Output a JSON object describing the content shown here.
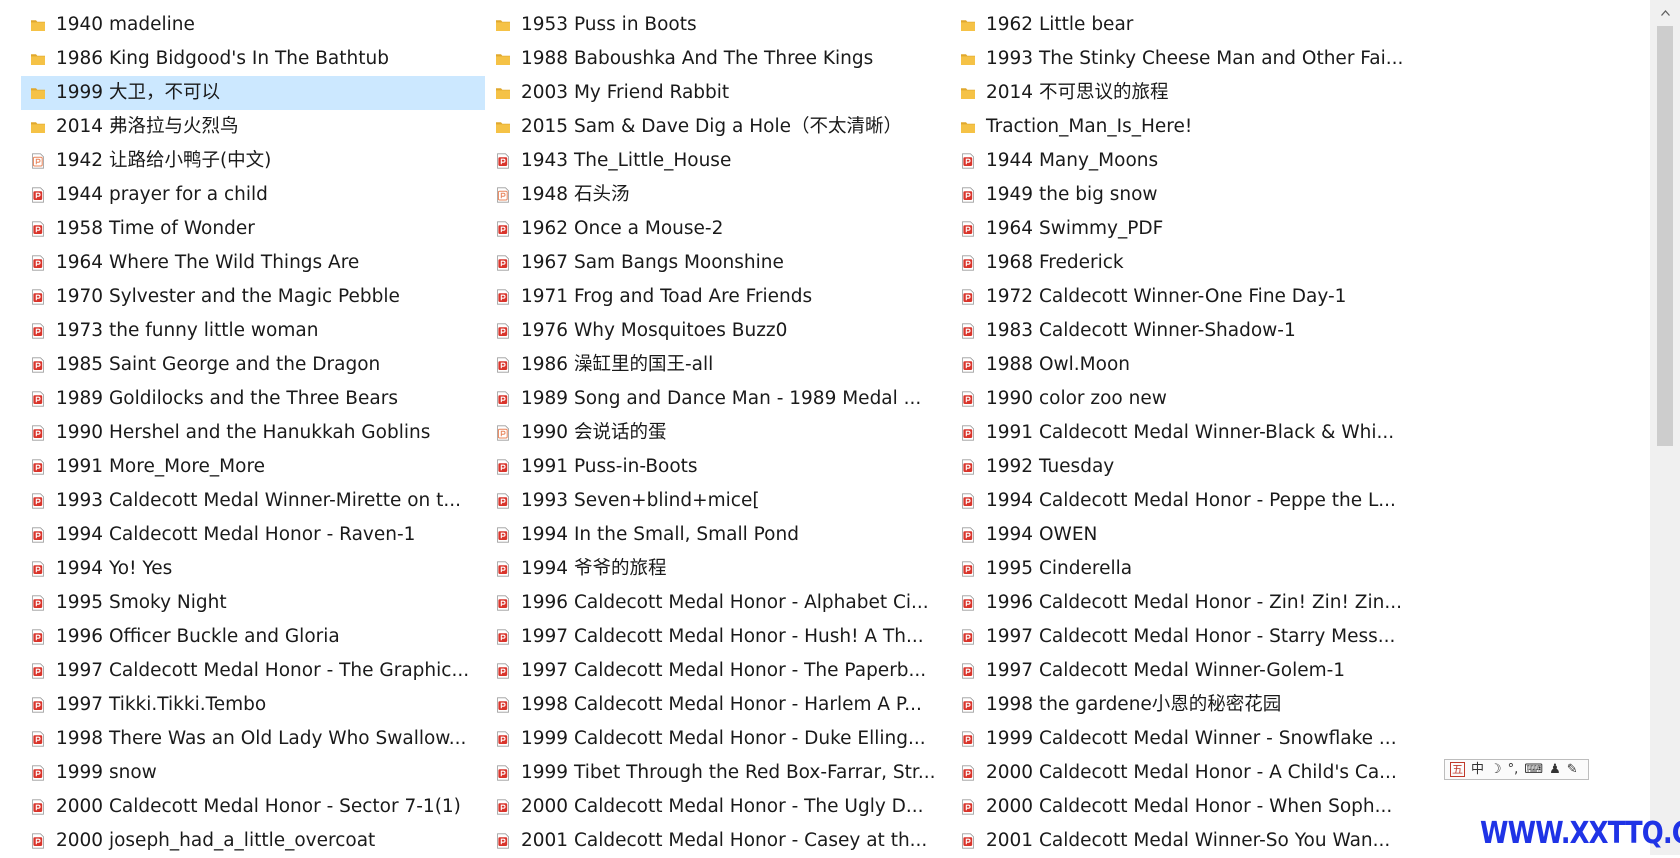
{
  "columns": [
    [
      {
        "type": "folder",
        "name": "1940 madeline"
      },
      {
        "type": "folder",
        "name": "1986 King Bidgood's In The Bathtub"
      },
      {
        "type": "folder",
        "name": "1999 大卫，不可以",
        "selected": true
      },
      {
        "type": "folder",
        "name": "2014 弗洛拉与火烈鸟"
      },
      {
        "type": "pdf-light",
        "name": "1942 让路给小鸭子(中文)"
      },
      {
        "type": "pdf",
        "name": "1944 prayer for a child"
      },
      {
        "type": "pdf",
        "name": "1958 Time of Wonder"
      },
      {
        "type": "pdf",
        "name": "1964 Where The Wild Things Are"
      },
      {
        "type": "pdf",
        "name": "1970 Sylvester and the Magic Pebble"
      },
      {
        "type": "pdf",
        "name": "1973 the funny little woman"
      },
      {
        "type": "pdf",
        "name": "1985 Saint George and the Dragon"
      },
      {
        "type": "pdf",
        "name": "1989 Goldilocks and the Three Bears"
      },
      {
        "type": "pdf",
        "name": "1990 Hershel and the Hanukkah Goblins"
      },
      {
        "type": "pdf",
        "name": "1991 More_More_More"
      },
      {
        "type": "pdf",
        "name": "1993 Caldecott Medal Winner-Mirette on t..."
      },
      {
        "type": "pdf",
        "name": "1994 Caldecott Medal Honor - Raven-1"
      },
      {
        "type": "pdf",
        "name": "1994 Yo! Yes"
      },
      {
        "type": "pdf",
        "name": "1995 Smoky Night"
      },
      {
        "type": "pdf",
        "name": "1996 Officer Buckle and Gloria"
      },
      {
        "type": "pdf",
        "name": "1997 Caldecott Medal Honor - The Graphic..."
      },
      {
        "type": "pdf",
        "name": "1997 Tikki.Tikki.Tembo"
      },
      {
        "type": "pdf",
        "name": "1998 There Was an Old Lady Who Swallow..."
      },
      {
        "type": "pdf",
        "name": "1999 snow"
      },
      {
        "type": "pdf",
        "name": "2000 Caldecott Medal Honor - Sector 7-1(1)"
      },
      {
        "type": "pdf",
        "name": "2000 joseph_had_a_little_overcoat"
      }
    ],
    [
      {
        "type": "folder",
        "name": "1953 Puss in Boots"
      },
      {
        "type": "folder",
        "name": "1988 Baboushka And The Three Kings"
      },
      {
        "type": "folder",
        "name": "2003 My Friend Rabbit"
      },
      {
        "type": "folder",
        "name": "2015 Sam & Dave Dig a Hole（不太清晰）"
      },
      {
        "type": "pdf",
        "name": "1943 The_Little_House"
      },
      {
        "type": "pdf-light",
        "name": "1948 石头汤"
      },
      {
        "type": "pdf",
        "name": "1962 Once a Mouse-2"
      },
      {
        "type": "pdf",
        "name": "1967 Sam Bangs Moonshine"
      },
      {
        "type": "pdf",
        "name": "1971 Frog and Toad Are Friends"
      },
      {
        "type": "pdf",
        "name": "1976 Why Mosquitoes Buzz0"
      },
      {
        "type": "pdf",
        "name": "1986 澡缸里的国王-all"
      },
      {
        "type": "pdf",
        "name": "1989 Song and Dance Man - 1989 Medal ..."
      },
      {
        "type": "pdf-light",
        "name": "1990 会说话的蛋"
      },
      {
        "type": "pdf",
        "name": "1991 Puss-in-Boots"
      },
      {
        "type": "pdf",
        "name": "1993 Seven+blind+mice["
      },
      {
        "type": "pdf",
        "name": "1994 In the Small, Small Pond"
      },
      {
        "type": "pdf",
        "name": "1994 爷爷的旅程"
      },
      {
        "type": "pdf",
        "name": "1996 Caldecott Medal Honor - Alphabet Ci..."
      },
      {
        "type": "pdf",
        "name": "1997 Caldecott Medal Honor - Hush! A Th..."
      },
      {
        "type": "pdf",
        "name": "1997 Caldecott Medal Honor - The Paperb..."
      },
      {
        "type": "pdf",
        "name": "1998 Caldecott Medal Honor - Harlem A P..."
      },
      {
        "type": "pdf",
        "name": "1999 Caldecott Medal Honor - Duke Elling..."
      },
      {
        "type": "pdf",
        "name": "1999 Tibet Through the Red Box-Farrar, Str..."
      },
      {
        "type": "pdf",
        "name": "2000 Caldecott Medal Honor - The Ugly D..."
      },
      {
        "type": "pdf",
        "name": "2001 Caldecott Medal Honor - Casey at th..."
      }
    ],
    [
      {
        "type": "folder",
        "name": "1962 Little bear"
      },
      {
        "type": "folder",
        "name": "1993 The Stinky Cheese Man and Other Fai..."
      },
      {
        "type": "folder",
        "name": "2014 不可思议的旅程"
      },
      {
        "type": "folder",
        "name": "Traction_Man_Is_Here!"
      },
      {
        "type": "pdf",
        "name": "1944 Many_Moons"
      },
      {
        "type": "pdf",
        "name": "1949 the big snow"
      },
      {
        "type": "pdf",
        "name": "1964 Swimmy_PDF"
      },
      {
        "type": "pdf",
        "name": "1968 Frederick"
      },
      {
        "type": "pdf",
        "name": "1972 Caldecott Winner-One Fine Day-1"
      },
      {
        "type": "pdf",
        "name": "1983 Caldecott Winner-Shadow-1"
      },
      {
        "type": "pdf",
        "name": "1988 Owl.Moon"
      },
      {
        "type": "pdf",
        "name": "1990 color zoo new"
      },
      {
        "type": "pdf",
        "name": "1991 Caldecott Medal Winner-Black & Whi..."
      },
      {
        "type": "pdf",
        "name": "1992 Tuesday"
      },
      {
        "type": "pdf",
        "name": "1994 Caldecott Medal Honor - Peppe the L..."
      },
      {
        "type": "pdf",
        "name": "1994 OWEN"
      },
      {
        "type": "pdf",
        "name": "1995 Cinderella"
      },
      {
        "type": "pdf",
        "name": "1996 Caldecott Medal Honor - Zin! Zin! Zin..."
      },
      {
        "type": "pdf",
        "name": "1997 Caldecott Medal Honor - Starry Mess..."
      },
      {
        "type": "pdf",
        "name": "1997 Caldecott Medal Winner-Golem-1"
      },
      {
        "type": "pdf",
        "name": "1998 the gardene小恩的秘密花园"
      },
      {
        "type": "pdf",
        "name": "1999 Caldecott Medal Winner - Snowflake ..."
      },
      {
        "type": "pdf",
        "name": "2000 Caldecott Medal Honor - A Child's Ca..."
      },
      {
        "type": "pdf",
        "name": "2000 Caldecott Medal Honor - When Soph..."
      },
      {
        "type": "pdf",
        "name": "2001 Caldecott Medal Winner-So You Wan..."
      }
    ]
  ],
  "ime_toolbar": {
    "wu": "五",
    "zh": "中",
    "moon": "☽",
    "punct": "°,",
    "keyboard": "⌨",
    "user": "♟",
    "tool": "✎"
  },
  "watermark": "WWW.XXTTQ.COM",
  "colors": {
    "folder": "#f5c246",
    "folder_dark": "#e0a82e",
    "pdf_red": "#d9342b",
    "pdf_light": "#e8845a",
    "selected_bg": "#cce8ff",
    "watermark": "#1f33e6"
  }
}
